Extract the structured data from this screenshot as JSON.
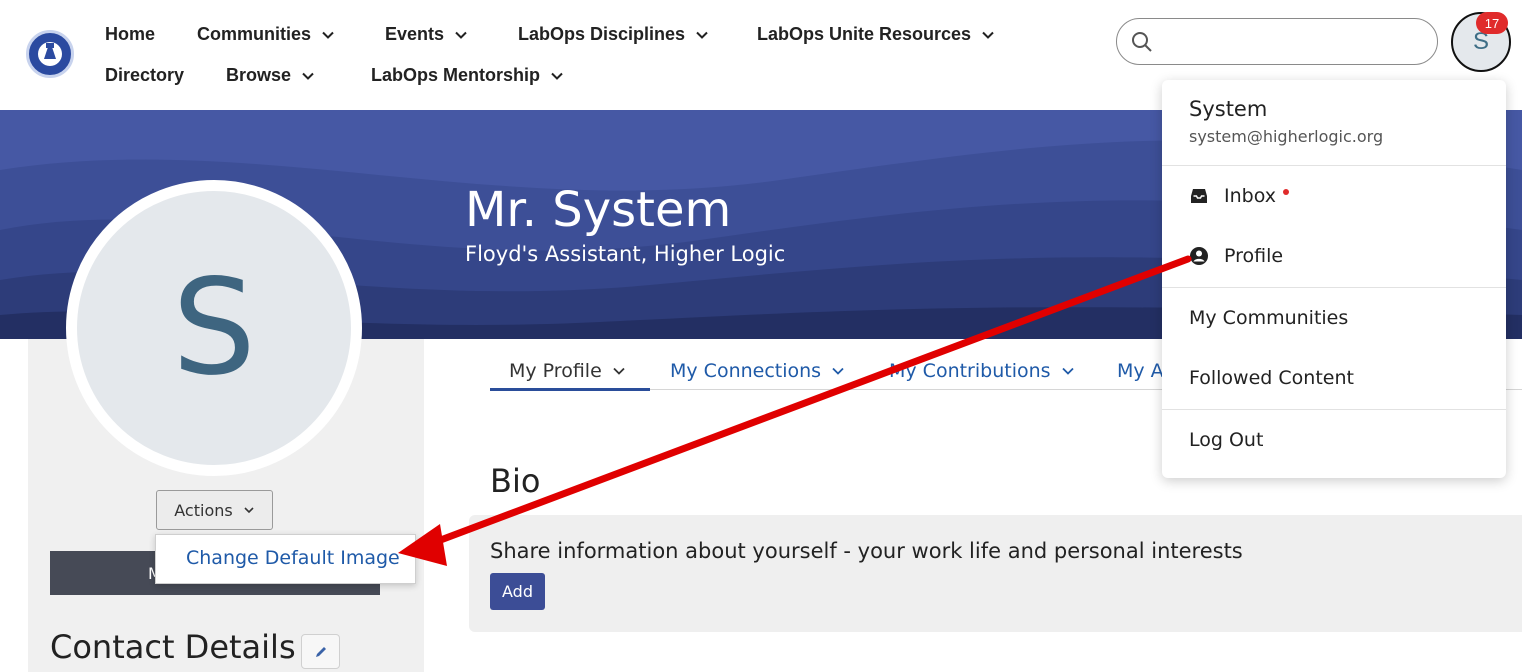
{
  "header": {
    "nav": [
      {
        "label": "Home",
        "has_dropdown": false
      },
      {
        "label": "Communities",
        "has_dropdown": true
      },
      {
        "label": "Events",
        "has_dropdown": true
      },
      {
        "label": "LabOps Disciplines",
        "has_dropdown": true
      },
      {
        "label": "LabOps Unite Resources",
        "has_dropdown": true
      },
      {
        "label": "Directory",
        "has_dropdown": false
      },
      {
        "label": "Browse",
        "has_dropdown": true
      },
      {
        "label": "LabOps Mentorship",
        "has_dropdown": true
      }
    ],
    "search": {
      "value": "",
      "placeholder": ""
    },
    "avatar_initial": "S",
    "notification_count": "17"
  },
  "profile": {
    "name": "Mr. System",
    "title": "Floyd's Assistant, Higher Logic",
    "avatar_initial": "S"
  },
  "actions": {
    "label": "Actions",
    "menu": [
      "Change Default Image"
    ]
  },
  "left_button_partial": "M",
  "contact": {
    "title": "Contact Details"
  },
  "tabs": [
    {
      "label": "My Profile",
      "active": true
    },
    {
      "label": "My Connections",
      "active": false
    },
    {
      "label": "My Contributions",
      "active": false
    },
    {
      "label": "My A",
      "active": false
    }
  ],
  "bio": {
    "title": "Bio",
    "text": "Share information about yourself - your work life and personal interests",
    "add_label": "Add"
  },
  "user_menu": {
    "name": "System",
    "email": "system@higherlogic.org",
    "items": [
      {
        "label": "Inbox",
        "icon": "inbox-icon",
        "unread": true
      },
      {
        "label": "Profile",
        "icon": "user-circle-icon",
        "unread": false
      },
      {
        "label": "My Communities",
        "icon": "",
        "unread": false
      },
      {
        "label": "Followed Content",
        "icon": "",
        "unread": false
      },
      {
        "label": "Log Out",
        "icon": "",
        "unread": false
      }
    ]
  },
  "colors": {
    "banner": "#4256a0",
    "link_blue": "#1f5aa8",
    "accent_button": "#3c4d96",
    "annotation_arrow": "#e00000",
    "badge": "#e02b2b"
  }
}
